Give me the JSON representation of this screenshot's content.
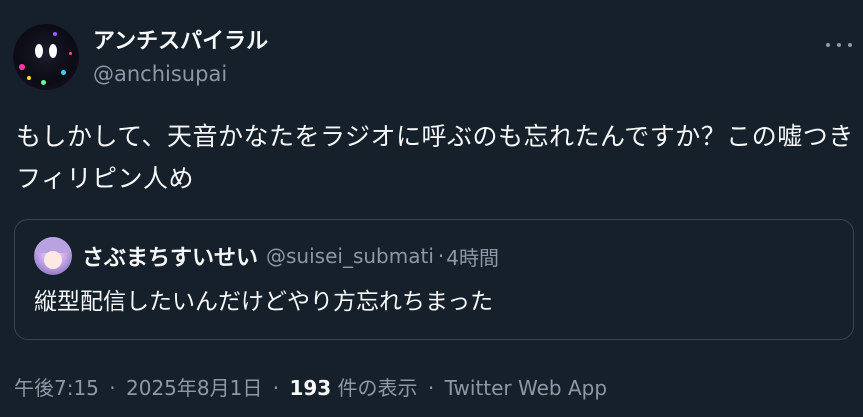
{
  "author": {
    "display_name": "アンチスパイラル",
    "handle": "@anchisupai"
  },
  "tweet": {
    "text": "もしかして、天音かなたをラジオに呼ぶのも忘れたんですか？この嘘つきフィリピン人め"
  },
  "quoted_tweet": {
    "display_name": "さぶまちすいせい",
    "handle": "@suisei_submati",
    "separator": "·",
    "time": "4時間",
    "text": "縦型配信したいんだけどやり方忘れちまった"
  },
  "meta": {
    "time": "午後7:15",
    "date": "2025年8月1日",
    "views_count": "193",
    "views_label": "件の表示",
    "source": "Twitter Web App",
    "separator": "·"
  },
  "icons": {
    "more": "more-horizontal-icon",
    "author_avatar": "avatar",
    "quoted_avatar": "avatar"
  },
  "colors": {
    "background": "#15202b",
    "primary_text": "#f7f9f9",
    "secondary_text": "#8b98a5",
    "border": "#38444d"
  }
}
